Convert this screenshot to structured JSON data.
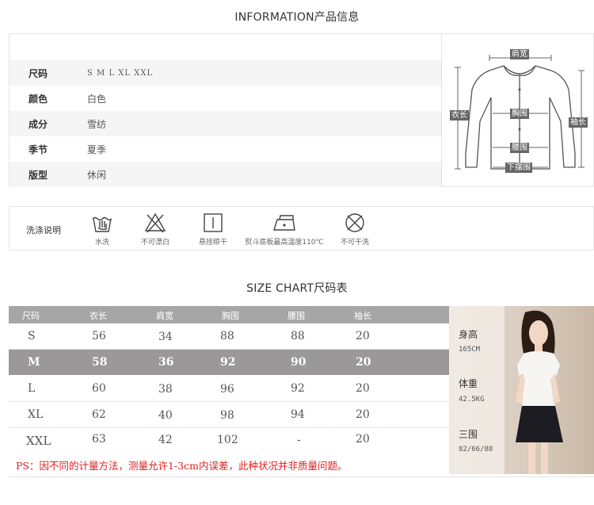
{
  "info_section": {
    "title": "INFORMATION产品信息",
    "rows": [
      {
        "label": "",
        "value": ""
      },
      {
        "label": "尺码",
        "value": "S  M  L  XL  XXL"
      },
      {
        "label": "颜色",
        "value": "白色"
      },
      {
        "label": "成分",
        "value": "雪纺"
      },
      {
        "label": "季节",
        "value": "夏季"
      },
      {
        "label": "版型",
        "value": "休闲"
      }
    ]
  },
  "diagram": {
    "labels": {
      "shoulder": "肩宽",
      "length": "衣长",
      "chest": "胸围",
      "waist": "腰围",
      "sleeve": "袖长",
      "hem": "下摆围"
    }
  },
  "care": {
    "label": "洗涤说明",
    "items": [
      {
        "icon": "hand-wash-icon",
        "text": "水洗"
      },
      {
        "icon": "no-bleach-icon",
        "text": "不可漂白"
      },
      {
        "icon": "hang-dry-icon",
        "text": "悬挂晾干"
      },
      {
        "icon": "iron-icon",
        "text": "熨斗底板最高温度110℃"
      },
      {
        "icon": "no-dry-clean-icon",
        "text": "不可干洗"
      }
    ]
  },
  "size_section": {
    "title": "SIZE CHART尺码表",
    "headers": [
      "尺码",
      "衣长",
      "肩宽",
      "胸围",
      "腰围",
      "袖长"
    ],
    "rows": [
      [
        "S",
        "56",
        "34",
        "88",
        "88",
        "20"
      ],
      [
        "M",
        "58",
        "36",
        "92",
        "90",
        "20"
      ],
      [
        "L",
        "60",
        "38",
        "96",
        "92",
        "20"
      ],
      [
        "XL",
        "62",
        "40",
        "98",
        "94",
        "20"
      ],
      [
        "XXL",
        "63",
        "42",
        "102",
        "-",
        "20"
      ]
    ],
    "highlight_row": 1,
    "note": "PS：因不同的计量方法，测量允许1-3cm内误差，此种状况并非质量问题。"
  },
  "model": {
    "stats": [
      {
        "label": "身高",
        "value": "165CM"
      },
      {
        "label": "体重",
        "value": "42.5KG"
      },
      {
        "label": "三围",
        "value": "82/66/88"
      }
    ]
  },
  "colors": {
    "table_header": "#a7a6a6",
    "highlight_row": "#9a9898",
    "note_red": "#e02020",
    "model_bg": "#d9ccbf"
  }
}
